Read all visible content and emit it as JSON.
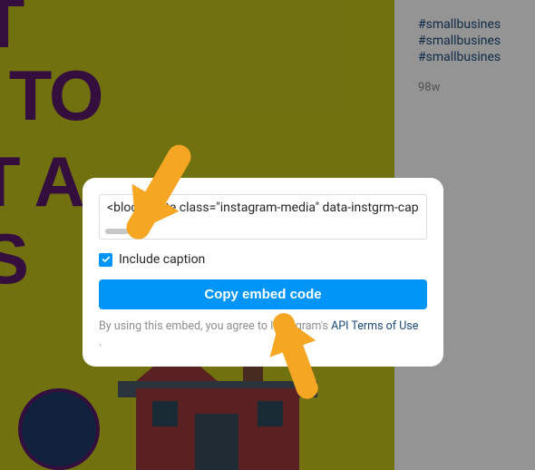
{
  "background": {
    "line1": "IT",
    "line2": "S TO",
    "line3": "T A",
    "line4": "ESS"
  },
  "sidebar": {
    "hashtags": [
      "#smallbusines",
      "#smallbusines",
      "#smallbusines"
    ],
    "age": "98w"
  },
  "modal": {
    "embed_code": "<blockquote class=\"instagram-media\" data-instgrm-cap",
    "include_caption_label": "Include caption",
    "include_caption_checked": true,
    "copy_button_label": "Copy embed code",
    "legal_pre": "By using this embed, you agree to ",
    "legal_brand": "Instagram's ",
    "legal_link": "API Terms of Use",
    "legal_post": "."
  },
  "colors": {
    "accent": "#0095f6",
    "arrow": "#f5a623"
  }
}
